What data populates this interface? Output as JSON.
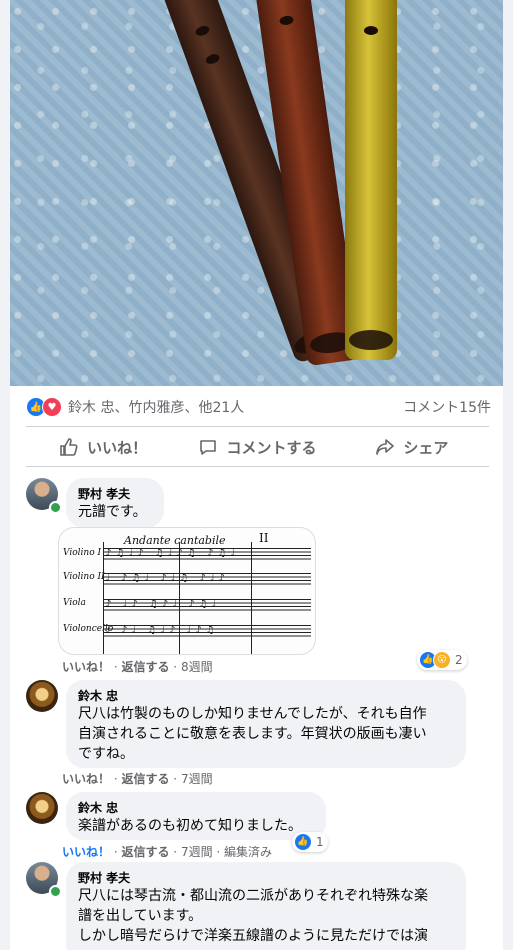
{
  "post": {
    "reaction_names": "鈴木 忠、竹内雅彦、他21人",
    "comment_count": "コメント15件",
    "actions": {
      "like": "いいね！",
      "comment": "コメントする",
      "share": "シェア"
    }
  },
  "comments": [
    {
      "author": "野村 孝夫",
      "text": "元譜です。",
      "meta_like": "いいね！",
      "meta_reply": "返信する",
      "meta_time": "8週間",
      "reaction_count": "2",
      "score": {
        "tempo": "Andante cantabile",
        "number": "II",
        "instruments": [
          "Violino I",
          "Violino II",
          "Viola",
          "Violoncello"
        ]
      }
    },
    {
      "author": "鈴木 忠",
      "text_lines": [
        "尺八は竹製のものしか知りませんでしたが、それも自作",
        "自演されることに敬意を表します。年賀状の版画も凄い",
        "ですね。"
      ],
      "meta_like": "いいね！",
      "meta_reply": "返信する",
      "meta_time": "7週間"
    },
    {
      "author": "鈴木 忠",
      "text": "楽譜があるのも初めて知りました。",
      "meta_like": "いいね！",
      "meta_reply": "返信する",
      "meta_time": "7週間",
      "meta_edited": "編集済み",
      "reaction_count": "1"
    },
    {
      "author": "野村 孝夫",
      "text_lines": [
        "尺八には琴古流・都山流の二派がありそれぞれ特殊な楽",
        "譜を出しています。",
        "しかし暗号だらけで洋楽五線譜のように見ただけでは演"
      ]
    }
  ],
  "colors": {
    "accent": "#1877f2",
    "love": "#f33e58",
    "online": "#31a24c"
  }
}
